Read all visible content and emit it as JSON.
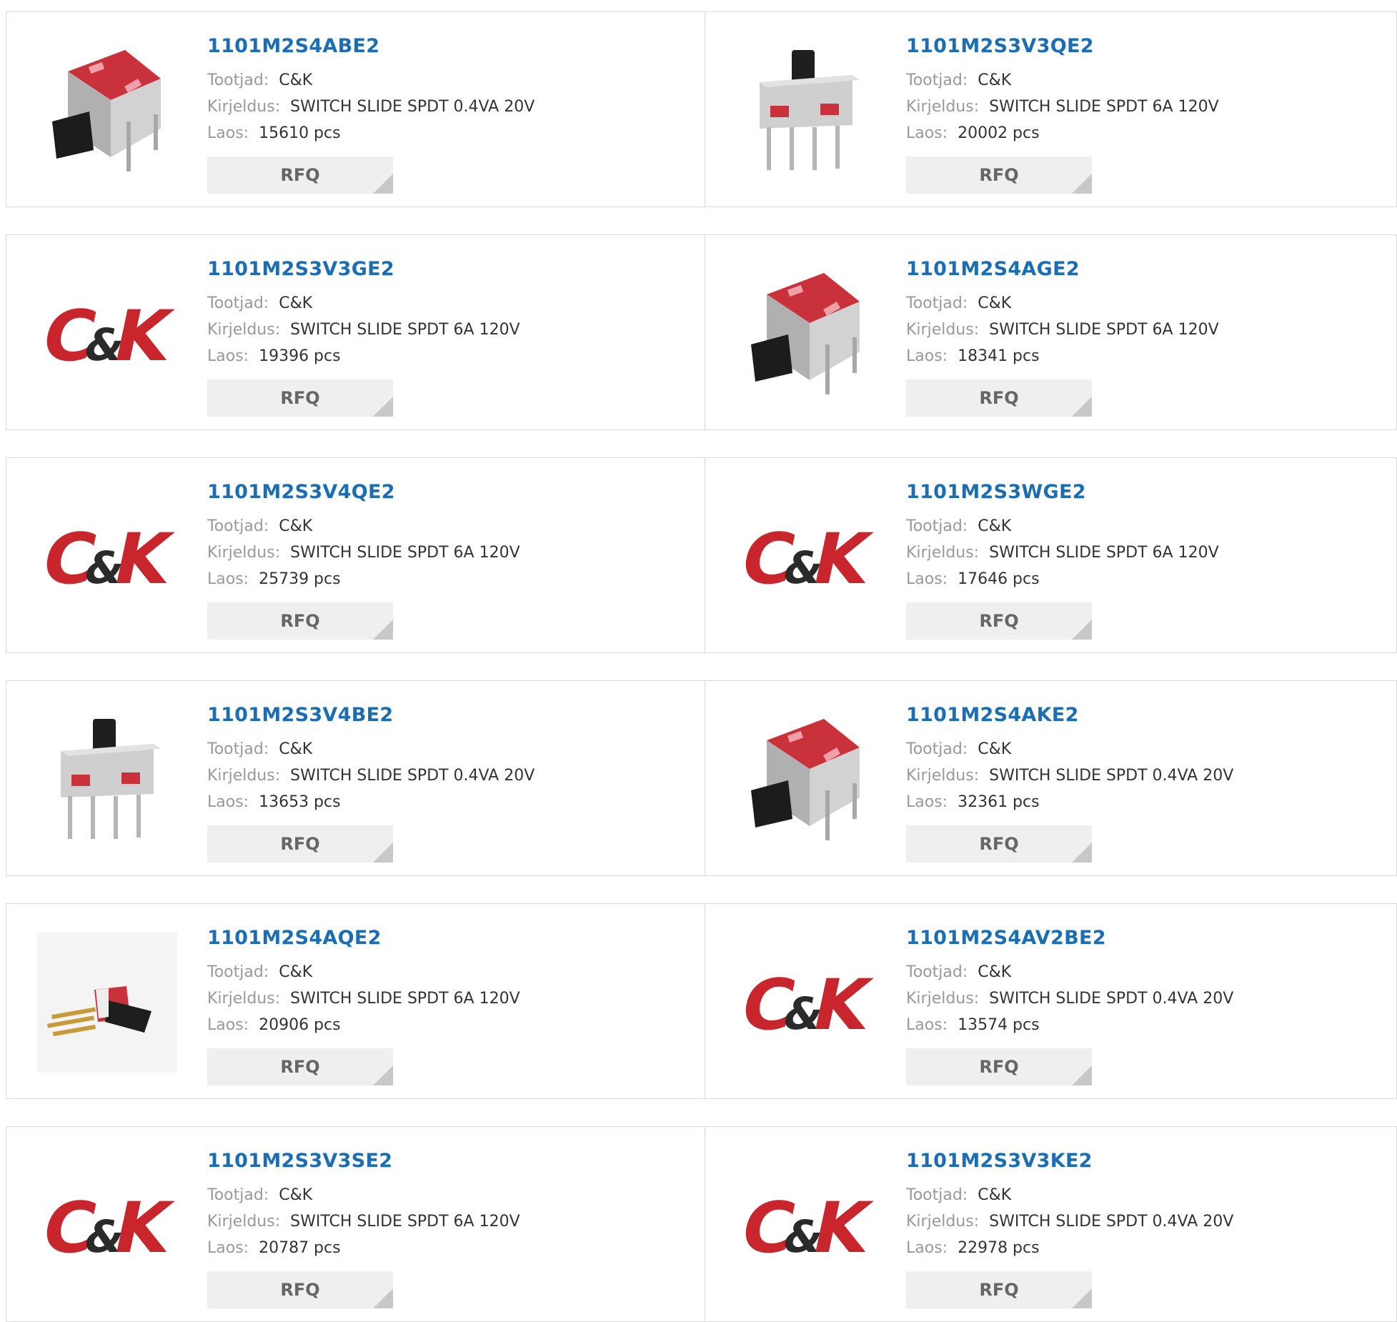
{
  "labels": {
    "manufacturer": "Tootjad:",
    "description": "Kirjeldus:",
    "stock": "Laos:",
    "rfq": "RFQ"
  },
  "colors": {
    "part_link": "#1b6db4",
    "label_gray": "#999999",
    "logo_red": "#c8262c",
    "switch_red": "#c9323a"
  },
  "products": [
    {
      "part": "1101M2S4ABE2",
      "manufacturer": "C&K",
      "description": "SWITCH SLIDE SPDT 0.4VA 20V",
      "stock": "15610 pcs",
      "image": "switch-horizontal-photo"
    },
    {
      "part": "1101M2S3V3QE2",
      "manufacturer": "C&K",
      "description": "SWITCH SLIDE SPDT 6A 120V",
      "stock": "20002 pcs",
      "image": "switch-vertical-photo"
    },
    {
      "part": "1101M2S3V3GE2",
      "manufacturer": "C&K",
      "description": "SWITCH SLIDE SPDT 6A 120V",
      "stock": "19396 pcs",
      "image": "ck-logo"
    },
    {
      "part": "1101M2S4AGE2",
      "manufacturer": "C&K",
      "description": "SWITCH SLIDE SPDT 6A 120V",
      "stock": "18341 pcs",
      "image": "switch-horizontal-photo"
    },
    {
      "part": "1101M2S3V4QE2",
      "manufacturer": "C&K",
      "description": "SWITCH SLIDE SPDT 6A 120V",
      "stock": "25739 pcs",
      "image": "ck-logo"
    },
    {
      "part": "1101M2S3WGE2",
      "manufacturer": "C&K",
      "description": "SWITCH SLIDE SPDT 6A 120V",
      "stock": "17646 pcs",
      "image": "ck-logo"
    },
    {
      "part": "1101M2S3V4BE2",
      "manufacturer": "C&K",
      "description": "SWITCH SLIDE SPDT 0.4VA 20V",
      "stock": "13653 pcs",
      "image": "switch-vertical-photo"
    },
    {
      "part": "1101M2S4AKE2",
      "manufacturer": "C&K",
      "description": "SWITCH SLIDE SPDT 0.4VA 20V",
      "stock": "32361 pcs",
      "image": "switch-horizontal-photo"
    },
    {
      "part": "1101M2S4AQE2",
      "manufacturer": "C&K",
      "description": "SWITCH SLIDE SPDT 6A 120V",
      "stock": "20906 pcs",
      "image": "switch-side-photo"
    },
    {
      "part": "1101M2S4AV2BE2",
      "manufacturer": "C&K",
      "description": "SWITCH SLIDE SPDT 0.4VA 20V",
      "stock": "13574 pcs",
      "image": "ck-logo"
    },
    {
      "part": "1101M2S3V3SE2",
      "manufacturer": "C&K",
      "description": "SWITCH SLIDE SPDT 6A 120V",
      "stock": "20787 pcs",
      "image": "ck-logo"
    },
    {
      "part": "1101M2S3V3KE2",
      "manufacturer": "C&K",
      "description": "SWITCH SLIDE SPDT 0.4VA 20V",
      "stock": "22978 pcs",
      "image": "ck-logo"
    }
  ]
}
